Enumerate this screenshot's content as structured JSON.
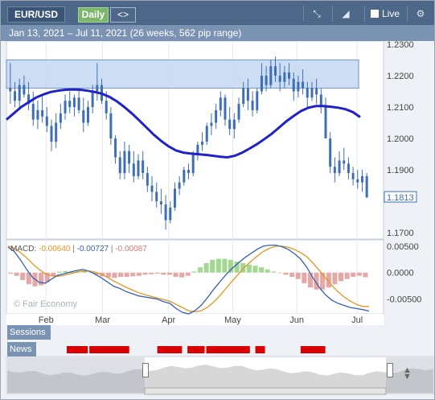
{
  "header": {
    "symbol": "EUR/USD",
    "timeframe": "Daily",
    "nav_icon": "<>",
    "live_label": "Live",
    "icons": [
      "draw-line-icon",
      "chart-type-icon",
      "checkbox-icon",
      "gear-icon"
    ]
  },
  "subtitle": "Jan 13, 2021 – Jul 11, 2021 (26 weeks, 562 pip range)",
  "watermark": "© Fair Economy",
  "rows": {
    "sessions": "Sessions",
    "news": "News"
  },
  "colors": {
    "candle": "#3d6fb6",
    "ma": "#1f22c8",
    "zone": "#c4d8f2",
    "macd_line": "#3560b5",
    "signal_line": "#e4961f",
    "hist_pos": "#a4d792",
    "hist_neg": "#e6a8a6",
    "news": "#d80000"
  },
  "chart_data": [
    {
      "type": "candlestick",
      "title": "",
      "x_ticks": [
        "Feb",
        "Mar",
        "Apr",
        "May",
        "Jun",
        "Jul"
      ],
      "y_ticks": [
        "1.2300",
        "1.2200",
        "1.2100",
        "1.2000",
        "1.1900",
        "1.1813",
        "1.1700"
      ],
      "ylim": [
        1.168,
        1.231
      ],
      "last_price": "1.1813",
      "ohlc": [
        [
          1.216,
          1.224,
          1.211,
          1.215
        ],
        [
          1.215,
          1.218,
          1.21,
          1.212
        ],
        [
          1.212,
          1.219,
          1.209,
          1.217
        ],
        [
          1.217,
          1.22,
          1.213,
          1.214
        ],
        [
          1.214,
          1.218,
          1.209,
          1.211
        ],
        [
          1.211,
          1.215,
          1.204,
          1.206
        ],
        [
          1.206,
          1.212,
          1.203,
          1.209
        ],
        [
          1.209,
          1.214,
          1.205,
          1.207
        ],
        [
          1.207,
          1.21,
          1.202,
          1.204
        ],
        [
          1.204,
          1.206,
          1.196,
          1.199
        ],
        [
          1.199,
          1.208,
          1.197,
          1.205
        ],
        [
          1.205,
          1.211,
          1.203,
          1.208
        ],
        [
          1.208,
          1.214,
          1.206,
          1.212
        ],
        [
          1.212,
          1.215,
          1.208,
          1.21
        ],
        [
          1.21,
          1.214,
          1.207,
          1.213
        ],
        [
          1.213,
          1.216,
          1.208,
          1.209
        ],
        [
          1.209,
          1.213,
          1.202,
          1.205
        ],
        [
          1.205,
          1.212,
          1.204,
          1.21
        ],
        [
          1.21,
          1.217,
          1.208,
          1.215
        ],
        [
          1.215,
          1.224,
          1.212,
          1.217
        ],
        [
          1.217,
          1.219,
          1.211,
          1.212
        ],
        [
          1.212,
          1.215,
          1.206,
          1.208
        ],
        [
          1.208,
          1.21,
          1.198,
          1.2
        ],
        [
          1.2,
          1.201,
          1.192,
          1.194
        ],
        [
          1.194,
          1.196,
          1.187,
          1.189
        ],
        [
          1.189,
          1.199,
          1.187,
          1.196
        ],
        [
          1.196,
          1.198,
          1.189,
          1.192
        ],
        [
          1.192,
          1.196,
          1.186,
          1.188
        ],
        [
          1.188,
          1.195,
          1.187,
          1.193
        ],
        [
          1.193,
          1.196,
          1.187,
          1.189
        ],
        [
          1.189,
          1.191,
          1.183,
          1.185
        ],
        [
          1.185,
          1.188,
          1.18,
          1.183
        ],
        [
          1.183,
          1.186,
          1.178,
          1.18
        ],
        [
          1.18,
          1.184,
          1.176,
          1.179
        ],
        [
          1.179,
          1.182,
          1.171,
          1.174
        ],
        [
          1.174,
          1.18,
          1.173,
          1.178
        ],
        [
          1.178,
          1.186,
          1.177,
          1.184
        ],
        [
          1.184,
          1.188,
          1.182,
          1.186
        ],
        [
          1.186,
          1.191,
          1.185,
          1.19
        ],
        [
          1.19,
          1.192,
          1.187,
          1.189
        ],
        [
          1.189,
          1.196,
          1.188,
          1.195
        ],
        [
          1.195,
          1.199,
          1.193,
          1.198
        ],
        [
          1.198,
          1.202,
          1.196,
          1.199
        ],
        [
          1.199,
          1.205,
          1.198,
          1.204
        ],
        [
          1.204,
          1.208,
          1.201,
          1.205
        ],
        [
          1.205,
          1.211,
          1.203,
          1.209
        ],
        [
          1.209,
          1.215,
          1.207,
          1.213
        ],
        [
          1.213,
          1.214,
          1.204,
          1.206
        ],
        [
          1.206,
          1.21,
          1.201,
          1.203
        ],
        [
          1.203,
          1.208,
          1.2,
          1.206
        ],
        [
          1.206,
          1.213,
          1.205,
          1.211
        ],
        [
          1.211,
          1.218,
          1.21,
          1.216
        ],
        [
          1.216,
          1.219,
          1.209,
          1.212
        ],
        [
          1.212,
          1.215,
          1.207,
          1.209
        ],
        [
          1.209,
          1.216,
          1.208,
          1.215
        ],
        [
          1.215,
          1.224,
          1.214,
          1.22
        ],
        [
          1.22,
          1.223,
          1.215,
          1.217
        ],
        [
          1.217,
          1.225,
          1.216,
          1.223
        ],
        [
          1.223,
          1.226,
          1.218,
          1.22
        ],
        [
          1.22,
          1.224,
          1.215,
          1.218
        ],
        [
          1.218,
          1.223,
          1.216,
          1.221
        ],
        [
          1.221,
          1.224,
          1.217,
          1.219
        ],
        [
          1.219,
          1.221,
          1.212,
          1.215
        ],
        [
          1.215,
          1.22,
          1.213,
          1.218
        ],
        [
          1.218,
          1.222,
          1.214,
          1.216
        ],
        [
          1.216,
          1.218,
          1.21,
          1.213
        ],
        [
          1.213,
          1.218,
          1.212,
          1.216
        ],
        [
          1.216,
          1.219,
          1.211,
          1.214
        ],
        [
          1.214,
          1.216,
          1.208,
          1.21
        ],
        [
          1.21,
          1.213,
          1.203,
          1.2
        ],
        [
          1.2,
          1.202,
          1.189,
          1.191
        ],
        [
          1.191,
          1.194,
          1.186,
          1.189
        ],
        [
          1.189,
          1.196,
          1.188,
          1.193
        ],
        [
          1.193,
          1.197,
          1.19,
          1.192
        ],
        [
          1.192,
          1.194,
          1.187,
          1.189
        ],
        [
          1.189,
          1.191,
          1.185,
          1.187
        ],
        [
          1.187,
          1.19,
          1.184,
          1.186
        ],
        [
          1.186,
          1.19,
          1.183,
          1.188
        ],
        [
          1.188,
          1.189,
          1.181,
          1.1813
        ]
      ],
      "moving_average": [
        1.206,
        1.208,
        1.21,
        1.2115,
        1.213,
        1.214,
        1.2148,
        1.2152,
        1.2155,
        1.2156,
        1.2155,
        1.2152,
        1.2148,
        1.2142,
        1.2132,
        1.2118,
        1.21,
        1.208,
        1.2058,
        1.2035,
        1.2012,
        1.1992,
        1.1975,
        1.1962,
        1.1955,
        1.1952,
        1.195,
        1.1948,
        1.1945,
        1.1942,
        1.194,
        1.1945,
        1.1955,
        1.1968,
        1.1982,
        1.1998,
        1.2015,
        1.2035,
        1.2055,
        1.2072,
        1.2088,
        1.2098,
        1.2103,
        1.2103,
        1.2101,
        1.2098,
        1.2093,
        1.2084,
        1.2068
      ],
      "zone": {
        "y_top": 1.225,
        "y_bottom": 1.216
      }
    },
    {
      "type": "macd",
      "title": "",
      "label": "MACD:",
      "values": [
        "-0.00640",
        "-0.00727",
        "-0.00087"
      ],
      "y_ticks": [
        "0.00500",
        "0.0000",
        "-0.00500"
      ],
      "ylim": [
        -0.0078,
        0.0062
      ],
      "macd": [
        0.0048,
        0.004,
        0.0024,
        0.0006,
        -0.001,
        -0.0018,
        -0.002,
        -0.0012,
        -0.0005,
        -0.0002,
        0.0001,
        0.0004,
        0.0006,
        0.0003,
        -0.0003,
        -0.001,
        -0.0018,
        -0.0026,
        -0.003,
        -0.0036,
        -0.004,
        -0.0044,
        -0.0046,
        -0.0048,
        -0.005,
        -0.0055,
        -0.0058,
        -0.0068,
        -0.0075,
        -0.0078,
        -0.0072,
        -0.0062,
        -0.0048,
        -0.0032,
        -0.0018,
        -0.0004,
        0.0008,
        0.0018,
        0.0028,
        0.0036,
        0.0044,
        0.005,
        0.0052,
        0.0052,
        0.0049,
        0.0044,
        0.0036,
        0.0026,
        0.001,
        -0.001,
        -0.0028,
        -0.0042,
        -0.0052,
        -0.0058,
        -0.0062,
        -0.0066,
        -0.0068,
        -0.007,
        -0.00727
      ],
      "signal": [
        0.005,
        0.0046,
        0.0038,
        0.0028,
        0.0016,
        0.0006,
        -0.0002,
        -0.0006,
        -0.0007,
        -0.0005,
        -0.0002,
        0.0001,
        0.0003,
        0.0003,
        0.0001,
        -0.0003,
        -0.0009,
        -0.0016,
        -0.0022,
        -0.0028,
        -0.0033,
        -0.0038,
        -0.0042,
        -0.0045,
        -0.0048,
        -0.0051,
        -0.0054,
        -0.006,
        -0.0066,
        -0.0072,
        -0.0074,
        -0.0072,
        -0.0066,
        -0.0056,
        -0.0044,
        -0.003,
        -0.0016,
        -0.0003,
        0.001,
        0.0021,
        0.0031,
        0.004,
        0.0046,
        0.005,
        0.005,
        0.0048,
        0.0044,
        0.0038,
        0.003,
        0.0018,
        0.0004,
        -0.001,
        -0.0024,
        -0.0036,
        -0.0046,
        -0.0054,
        -0.006,
        -0.0064,
        -0.0064
      ],
      "histogram": [
        -0.0002,
        -0.0006,
        -0.0014,
        -0.0022,
        -0.0026,
        -0.0024,
        -0.0018,
        -0.0006,
        0.0002,
        0.0003,
        0.0003,
        0.0003,
        0.0003,
        0.0,
        -0.0004,
        -0.0007,
        -0.0009,
        -0.001,
        -0.0008,
        -0.0008,
        -0.0007,
        -0.0006,
        -0.0004,
        -0.0003,
        -0.0002,
        -0.0004,
        -0.0004,
        -0.0008,
        -0.0009,
        -0.0006,
        0.0002,
        0.001,
        0.0018,
        0.0024,
        0.0026,
        0.0026,
        0.0024,
        0.0021,
        0.0018,
        0.0015,
        0.0013,
        0.001,
        0.0006,
        0.0002,
        -0.0001,
        -0.0004,
        -0.0008,
        -0.0012,
        -0.002,
        -0.0028,
        -0.0032,
        -0.0032,
        -0.0028,
        -0.0022,
        -0.0016,
        -0.0012,
        -0.0008,
        -0.0006,
        -0.00087
      ]
    }
  ],
  "news_events": [
    0.16,
    0.175,
    0.19,
    0.22,
    0.235,
    0.25,
    0.265,
    0.285,
    0.3,
    0.4,
    0.42,
    0.44,
    0.48,
    0.5,
    0.53,
    0.545,
    0.56,
    0.575,
    0.59,
    0.605,
    0.62,
    0.66,
    0.78,
    0.8,
    0.82
  ]
}
